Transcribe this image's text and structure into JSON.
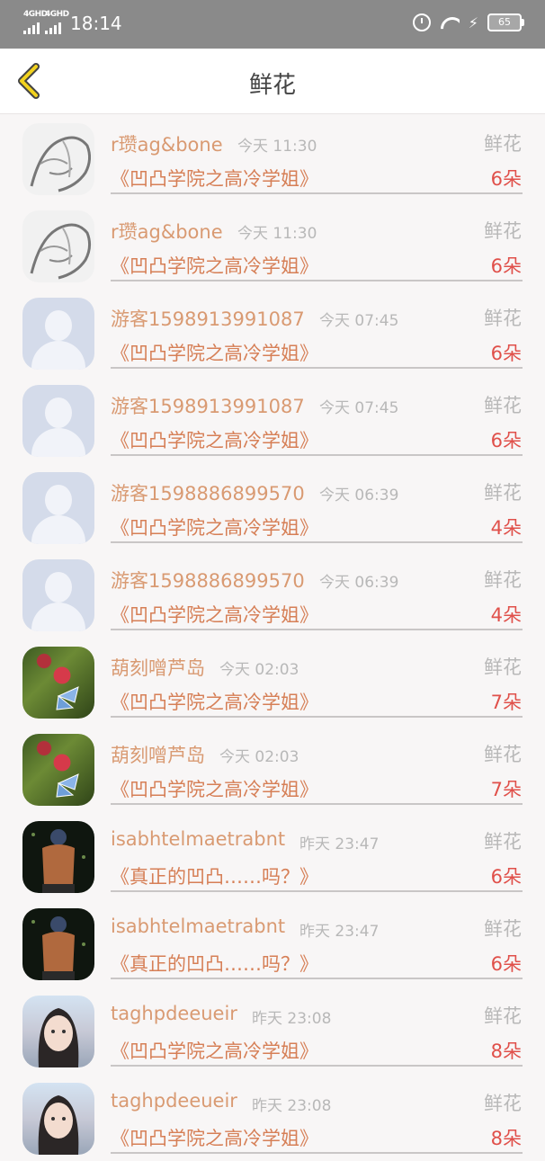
{
  "status_bar": {
    "signal1": "4GHD",
    "signal2": "4GHD",
    "time": "18:14",
    "battery": "65"
  },
  "header": {
    "title": "鲜花"
  },
  "records": [
    {
      "name": "r瓒ag&bone",
      "time": "今天 11:30",
      "type": "鲜花",
      "book": "《凹凸学院之高冷学姐》",
      "qty": "6朵",
      "avatar": "sketch"
    },
    {
      "name": "r瓒ag&bone",
      "time": "今天 11:30",
      "type": "鲜花",
      "book": "《凹凸学院之高冷学姐》",
      "qty": "6朵",
      "avatar": "sketch"
    },
    {
      "name": "游客1598913991087",
      "time": "今天 07:45",
      "type": "鲜花",
      "book": "《凹凸学院之高冷学姐》",
      "qty": "6朵",
      "avatar": "default"
    },
    {
      "name": "游客1598913991087",
      "time": "今天 07:45",
      "type": "鲜花",
      "book": "《凹凸学院之高冷学姐》",
      "qty": "6朵",
      "avatar": "default"
    },
    {
      "name": "游客1598886899570",
      "time": "今天 06:39",
      "type": "鲜花",
      "book": "《凹凸学院之高冷学姐》",
      "qty": "4朵",
      "avatar": "default"
    },
    {
      "name": "游客1598886899570",
      "time": "今天 06:39",
      "type": "鲜花",
      "book": "《凹凸学院之高冷学姐》",
      "qty": "4朵",
      "avatar": "default"
    },
    {
      "name": "葫刻噌芦岛",
      "time": "今天 02:03",
      "type": "鲜花",
      "book": "《凹凸学院之高冷学姐》",
      "qty": "7朵",
      "avatar": "flower"
    },
    {
      "name": "葫刻噌芦岛",
      "time": "今天 02:03",
      "type": "鲜花",
      "book": "《凹凸学院之高冷学姐》",
      "qty": "7朵",
      "avatar": "flower"
    },
    {
      "name": "isabhtelmaetrabnt",
      "time": "昨天 23:47",
      "type": "鲜花",
      "book": "《真正的凹凸……吗？》",
      "qty": "6朵",
      "avatar": "back"
    },
    {
      "name": "isabhtelmaetrabnt",
      "time": "昨天 23:47",
      "type": "鲜花",
      "book": "《真正的凹凸……吗？》",
      "qty": "6朵",
      "avatar": "back"
    },
    {
      "name": "taghpdeeueir",
      "time": "昨天 23:08",
      "type": "鲜花",
      "book": "《凹凸学院之高冷学姐》",
      "qty": "8朵",
      "avatar": "girl"
    },
    {
      "name": "taghpdeeueir",
      "time": "昨天 23:08",
      "type": "鲜花",
      "book": "《凹凸学院之高冷学姐》",
      "qty": "8朵",
      "avatar": "girl"
    }
  ]
}
